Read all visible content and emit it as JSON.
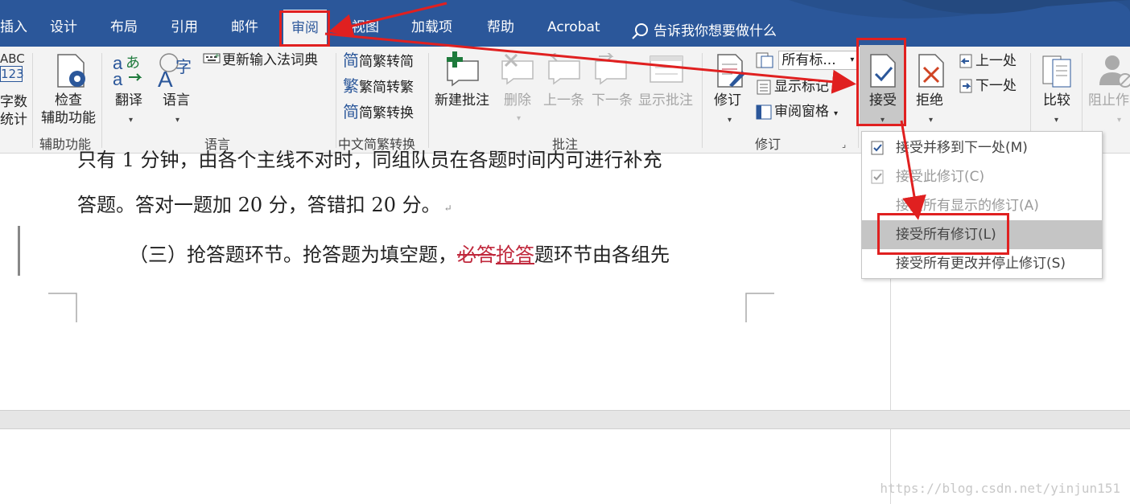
{
  "tabs": [
    "插入",
    "设计",
    "布局",
    "引用",
    "邮件",
    "审阅",
    "视图",
    "加载项",
    "帮助",
    "Acrobat"
  ],
  "tell_me": "告诉我你想要做什么",
  "proofing": {
    "abc_top": "ABC",
    "abc_num": "123",
    "word_count_1": "字数",
    "word_count_2": "统计"
  },
  "accessibility": {
    "check_1": "检查",
    "check_2": "辅助功能",
    "group_label": "辅助功能"
  },
  "language": {
    "translate": "翻译",
    "language": "语言",
    "update_ime": "更新输入法词典",
    "group_label": "语言"
  },
  "chinese_conversion": {
    "to_trad": "简繁转简",
    "to_simp": "繁简转繁",
    "convert": "简繁转换",
    "group_label": "中文简繁转换",
    "trad_glyph": "简",
    "simp_glyph": "繁",
    "conv_glyph": "简"
  },
  "comments": {
    "new": "新建批注",
    "delete": "删除",
    "prev": "上一条",
    "next": "下一条",
    "show": "显示批注",
    "group_label": "批注"
  },
  "tracking": {
    "track": "修订",
    "markup_select": "所有标...",
    "show_markup": "显示标记",
    "review_pane": "审阅窗格",
    "group_label": "修订"
  },
  "changes": {
    "accept": "接受",
    "reject": "拒绝",
    "previous": "上一处",
    "next": "下一处"
  },
  "compare": {
    "compare": "比较",
    "restrict": "阻止作"
  },
  "document": {
    "line1": "只有 1 分钟，由各个主线不对时，同组队员在各题时间内可进行补充",
    "line2": "答题。答对一题加 20 分，答错扣 20 分。",
    "para_mark": "↵",
    "line3_pre": "（三）抢答题环节。抢答题为填空题，",
    "line3_deleted": "必答",
    "line3_inserted": "抢答",
    "line3_post": "题环节由各组先"
  },
  "accept_menu": {
    "items": [
      {
        "label": "接受并移到下一处(M)",
        "checked": true
      },
      {
        "label": "接受此修订(C)",
        "checked": true
      },
      {
        "label": "接受所有显示的修订(A)",
        "checked": false
      },
      {
        "label": "接受所有修订(L)",
        "checked": false,
        "selected": true
      },
      {
        "label": "接受所有更改并停止修订(S)",
        "checked": false
      }
    ]
  },
  "watermark": "https://blog.csdn.net/yinjun151",
  "colors": {
    "titlebar": "#2b579a",
    "ribbon": "#f3f3f3",
    "annotation_red": "#e02020",
    "deleted_text": "#c0283c",
    "inserted_text": "#c0283c"
  }
}
